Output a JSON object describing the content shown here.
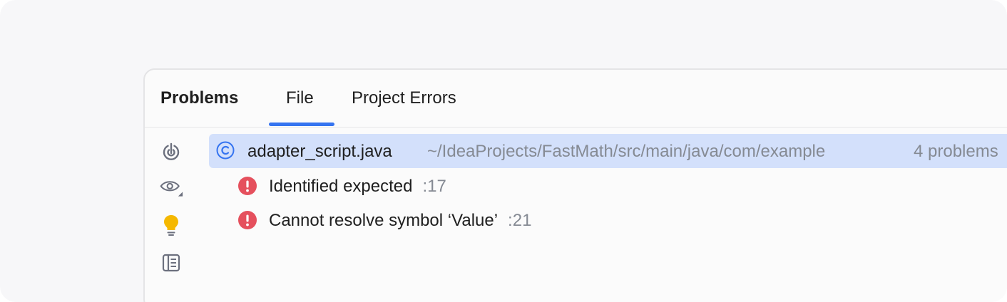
{
  "tabs": {
    "title": "Problems",
    "file_label": "File",
    "project_label": "Project Errors",
    "active": "File",
    "accent_color": "#3574f0"
  },
  "toolbar": {
    "icons": [
      "autoscroll-icon",
      "eye-icon",
      "bulb-icon",
      "preview-panel-icon"
    ],
    "bulb_color": "#f5b800"
  },
  "file": {
    "icon": "class-icon",
    "name": "adapter_script.java",
    "path": "~/IdeaProjects/FastMath/src/main/java/com/example",
    "count": "4 problems",
    "highlight_color": "#d3e0fb"
  },
  "problems": [
    {
      "icon": "error-icon",
      "message": "Identified expected",
      "line": ":17"
    },
    {
      "icon": "error-icon",
      "message": "Cannot resolve symbol ‘Value’",
      "line": ":21"
    }
  ],
  "colors": {
    "error": "#e5505d",
    "muted_text": "#858a93"
  }
}
